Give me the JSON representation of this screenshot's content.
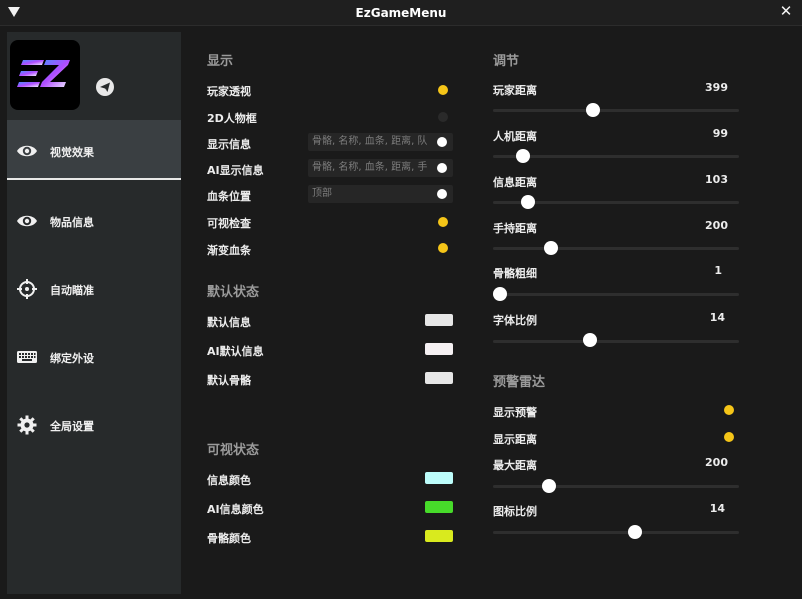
{
  "window": {
    "title": "EzGameMenu"
  },
  "sidebar": {
    "items": [
      {
        "label": "视觉效果",
        "icon": "eye-icon"
      },
      {
        "label": "物品信息",
        "icon": "eye-icon"
      },
      {
        "label": "自动瞄准",
        "icon": "crosshair-icon"
      },
      {
        "label": "绑定外设",
        "icon": "keyboard-icon"
      },
      {
        "label": "全局设置",
        "icon": "gear-icon"
      }
    ]
  },
  "display": {
    "title": "显示",
    "rows": [
      {
        "label": "玩家透视",
        "state": "on"
      },
      {
        "label": "2D人物框",
        "state": "off"
      },
      {
        "label": "显示信息",
        "combo": "骨骼, 名称, 血条, 距离, 队"
      },
      {
        "label": "AI显示信息",
        "combo": "骨骼, 名称, 血条, 距离, 手"
      },
      {
        "label": "血条位置",
        "combo": "顶部"
      },
      {
        "label": "可视检查",
        "state": "on"
      },
      {
        "label": "渐变血条",
        "state": "on"
      }
    ]
  },
  "default_state": {
    "title": "默认状态",
    "rows": [
      {
        "label": "默认信息",
        "color": "#e6e6e6"
      },
      {
        "label": "AI默认信息",
        "color": "#f5f0f2"
      },
      {
        "label": "默认骨骼",
        "color": "#e6e6e6"
      }
    ]
  },
  "visible_state": {
    "title": "可视状态",
    "rows": [
      {
        "label": "信息颜色",
        "color": "#bdfdfb"
      },
      {
        "label": "AI信息颜色",
        "color": "#47db2a"
      },
      {
        "label": "骨骼颜色",
        "color": "#d9ea1e"
      }
    ]
  },
  "adjust": {
    "title": "调节",
    "sliders": [
      {
        "label": "玩家距离",
        "value": "399",
        "fraction": 0.4
      },
      {
        "label": "人机距离",
        "value": "99",
        "fraction": 0.1
      },
      {
        "label": "信息距离",
        "value": "103",
        "fraction": 0.12
      },
      {
        "label": "手持距离",
        "value": "200",
        "fraction": 0.22
      },
      {
        "label": "骨骼粗细",
        "value": "1",
        "fraction": 0.0
      },
      {
        "label": "字体比例",
        "value": "14",
        "fraction": 0.39
      }
    ]
  },
  "radar": {
    "title": "预警雷达",
    "toggles": [
      {
        "label": "显示预警",
        "state": "on"
      },
      {
        "label": "显示距离",
        "state": "on"
      }
    ],
    "sliders": [
      {
        "label": "最大距离",
        "value": "200",
        "fraction": 0.21
      },
      {
        "label": "图标比例",
        "value": "14",
        "fraction": 0.58
      }
    ]
  },
  "colors": {
    "accent": "#f5c518",
    "panel": "#272a2b",
    "background": "#1a1a1a"
  }
}
